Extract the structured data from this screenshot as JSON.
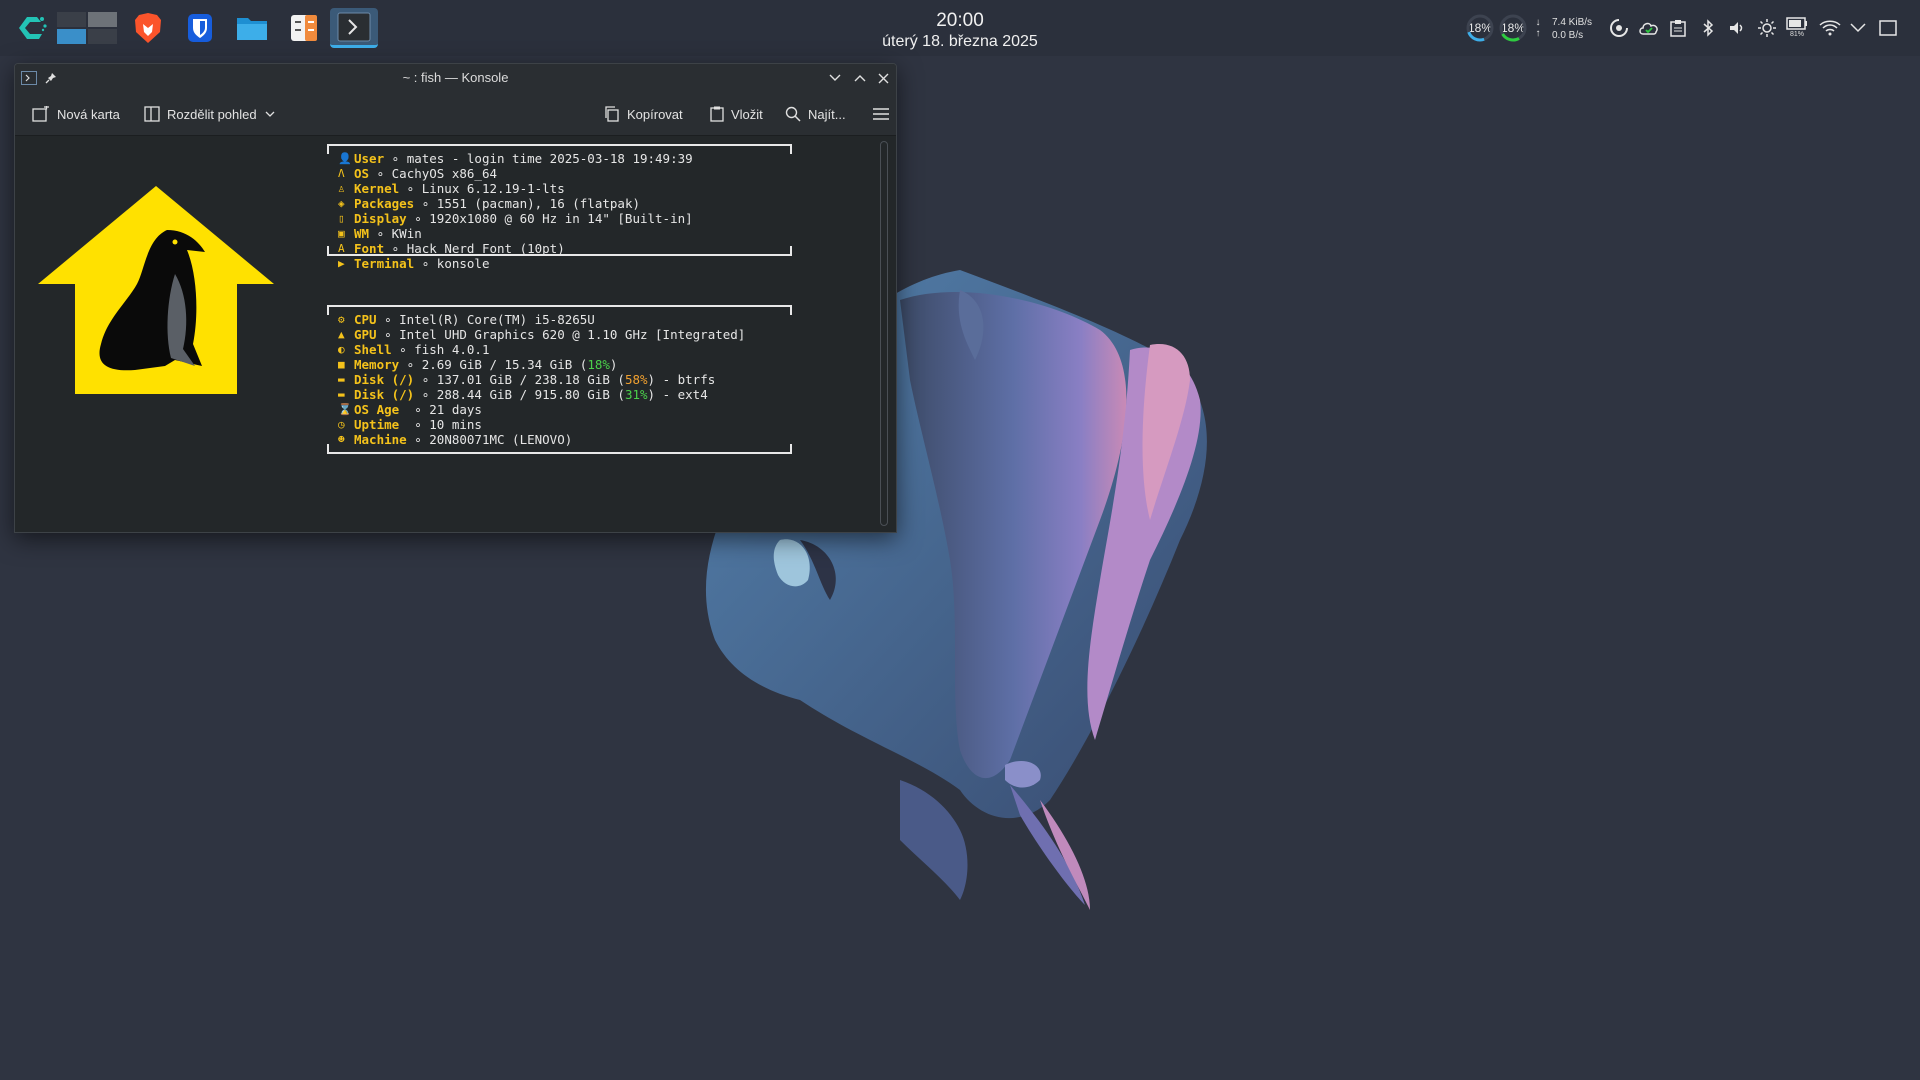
{
  "panel": {
    "launchers": [
      {
        "name": "cachyos-menu",
        "icon": "cachyos-logo-icon"
      },
      {
        "name": "virtual-desktops",
        "icon": "pager-icon"
      },
      {
        "name": "brave",
        "icon": "brave-lion-icon"
      },
      {
        "name": "bitwarden",
        "icon": "bitwarden-shield-icon"
      },
      {
        "name": "files",
        "icon": "folder-icon"
      },
      {
        "name": "calculator",
        "icon": "calculator-icon"
      },
      {
        "name": "konsole",
        "icon": "terminal-icon"
      }
    ],
    "clock": {
      "time": "20:00",
      "date": "úterý 18. března 2025"
    },
    "tray": {
      "cpu": "18%",
      "mem": "18%",
      "net_down": "7.4 KiB/s",
      "net_up": "0.0 B/s",
      "battery": "81%"
    }
  },
  "konsole": {
    "title": "~ : fish — Konsole",
    "toolbar": {
      "new_tab": "Nová karta",
      "split_view": "Rozdělit pohled",
      "copy": "Kopírovat",
      "paste": "Vložit",
      "find": "Najít..."
    },
    "fetch_block1": [
      {
        "icon": "user-icon",
        "glyph": "👤",
        "key": "User",
        "value": "mates - login time 2025-03-18 19:49:39"
      },
      {
        "icon": "arch-icon",
        "glyph": "Λ",
        "key": "OS",
        "value": "CachyOS x86_64"
      },
      {
        "icon": "linux-icon",
        "glyph": "♙",
        "key": "Kernel",
        "value": "Linux 6.12.19-1-lts"
      },
      {
        "icon": "package-icon",
        "glyph": "◈",
        "key": "Packages",
        "value": "1551 (pacman), 16 (flatpak)"
      },
      {
        "icon": "display-icon",
        "glyph": "▯",
        "key": "Display",
        "value": "1920x1080 @ 60 Hz in 14\" [Built-in]"
      },
      {
        "icon": "window-icon",
        "glyph": "▣",
        "key": "WM",
        "value": "KWin"
      },
      {
        "icon": "font-icon",
        "glyph": "A",
        "key": "Font",
        "value": "Hack Nerd Font (10pt)"
      },
      {
        "icon": "terminal-small-icon",
        "glyph": "▶",
        "key": "Terminal",
        "value": "konsole"
      }
    ],
    "fetch_block2": [
      {
        "icon": "cpu-icon",
        "glyph": "⚙",
        "key": "CPU",
        "value": "Intel(R) Core(TM) i5-8265U"
      },
      {
        "icon": "gpu-icon",
        "glyph": "▲",
        "key": "GPU",
        "value": "Intel UHD Graphics 620 @ 1.10 GHz [Integrated]"
      },
      {
        "icon": "shell-icon",
        "glyph": "◐",
        "key": "Shell",
        "value": "fish 4.0.1"
      },
      {
        "icon": "memory-icon",
        "glyph": "■",
        "key": "Memory",
        "value_pre": "2.69 GiB / 15.34 GiB (",
        "pct": "18%",
        "pct_color": "green",
        "value_post": ")"
      },
      {
        "icon": "disk-icon",
        "glyph": "▬",
        "key": "Disk (/)",
        "value_pre": "137.01 GiB / 238.18 GiB (",
        "pct": "58%",
        "pct_color": "yellow",
        "value_post": ") - btrfs"
      },
      {
        "icon": "disk-icon",
        "glyph": "▬",
        "key": "Disk (/)",
        "value_pre": "288.44 GiB / 915.80 GiB (",
        "pct": "31%",
        "pct_color": "green",
        "value_post": ") - ext4"
      },
      {
        "icon": "hourglass-icon",
        "glyph": "⌛",
        "key": "OS Age ",
        "value": "21 days"
      },
      {
        "icon": "uptime-icon",
        "glyph": "◷",
        "key": "Uptime ",
        "value": "10 mins"
      },
      {
        "icon": "machine-icon",
        "glyph": "☻",
        "key": "Machine",
        "value": "20N80071MC (LENOVO)"
      }
    ],
    "color_dots": [
      "#e8e8e8",
      "#f4f4f4",
      "#1abc9c",
      "#9b59b6",
      "#3498db",
      "#e67e22",
      "#2ecc40",
      "#e0202a"
    ],
    "prompt": "~"
  },
  "colors": {
    "accent": "#3daee9",
    "fetch_key": "#f4c21b",
    "desktop_bg": "#2f3441"
  }
}
